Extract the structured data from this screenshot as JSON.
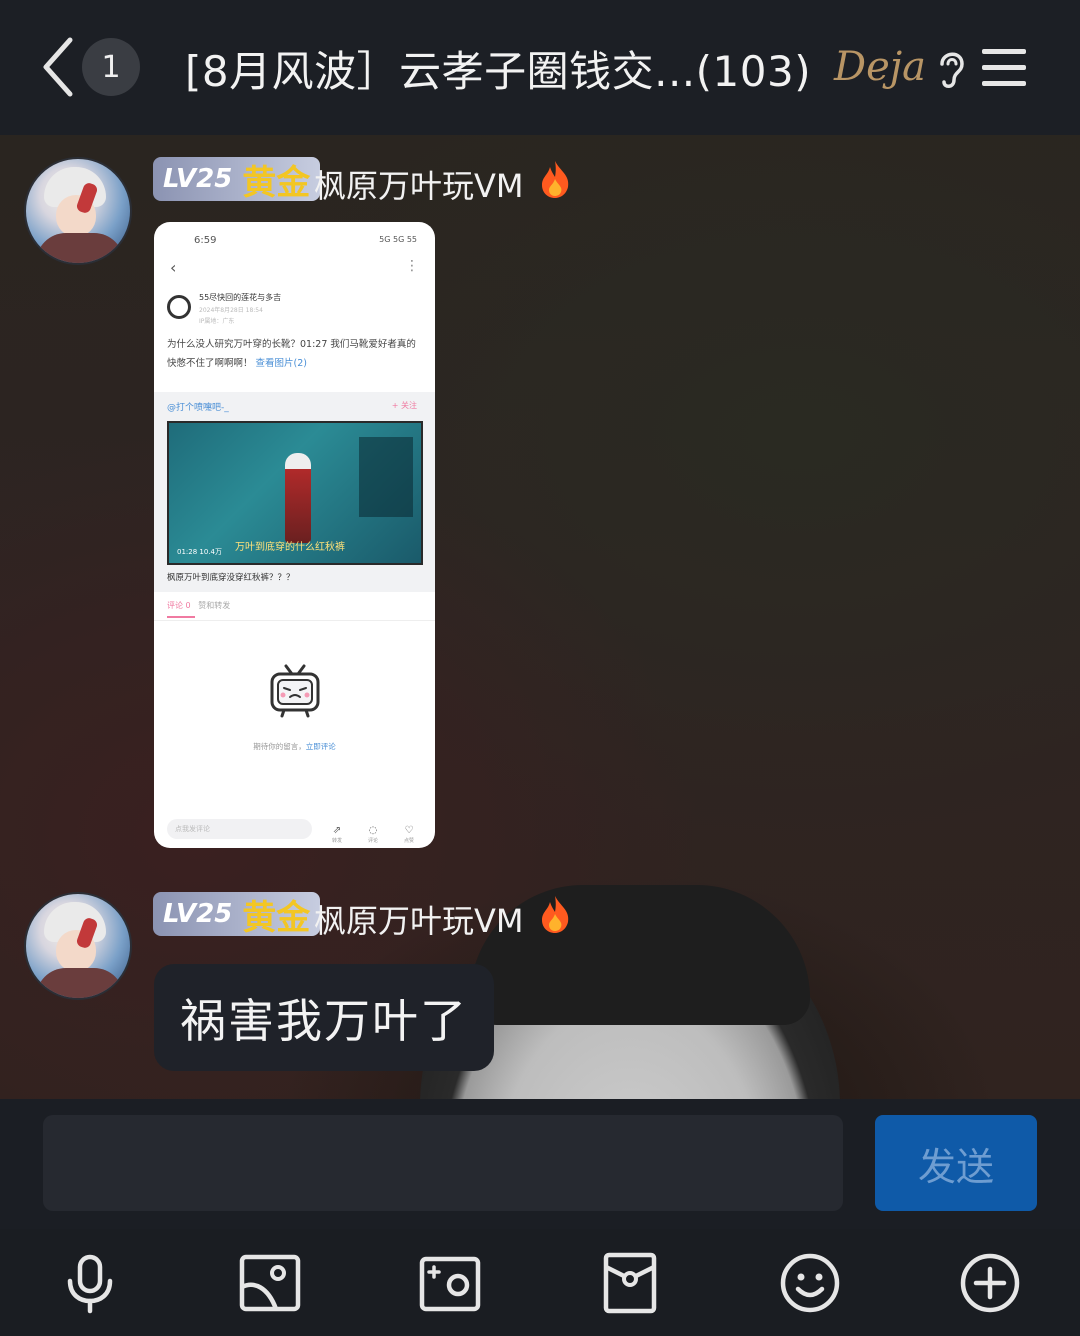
{
  "header": {
    "unread_count": "1",
    "title": "[8月风波］云孝子圈钱交...(103)",
    "brand_text": "Deja"
  },
  "messages": [
    {
      "level": "LV25",
      "rank": "黄金",
      "sender": "枫原万叶玩VM",
      "type": "image",
      "screenshot": {
        "status_time": "6:59",
        "status_right": "5G 5G 55",
        "post_author": "55尽快回的莲花与多吉",
        "post_date": "2024年8月28日 18:54",
        "post_location": "IP属地：广东",
        "post_text": "为什么没人研究万叶穿的长靴？01:27 我们马靴爱好者真的快憋不住了啊啊啊！",
        "post_link": "查看图片(2)",
        "at_user": "@打个喷嚏吧-_",
        "follow": "+ 关注",
        "video_caption_overlay": "万叶到底穿的什么红秋裤",
        "video_time": "01:28",
        "video_views": "10.4万",
        "video_title": "枫原万叶到底穿没穿红秋裤？？？",
        "tab_comments": "评论 0",
        "tab_repost": "赞和转发",
        "empty_text": "期待你的留言，",
        "empty_link": "立即评论",
        "input_placeholder": "点我发评论",
        "act_share": "转发",
        "act_comment": "评论",
        "act_like": "点赞"
      }
    },
    {
      "level": "LV25",
      "rank": "黄金",
      "sender": "枫原万叶玩VM",
      "type": "text",
      "text": "祸害我万叶了"
    }
  ],
  "input": {
    "value": "",
    "send_label": "发送"
  },
  "toolbar": {
    "icons": [
      "microphone-icon",
      "image-icon",
      "camera-icon",
      "red-packet-icon",
      "emoji-icon",
      "plus-icon"
    ]
  },
  "colors": {
    "header_bg": "#1c1f25",
    "send_button": "#0f5aa8",
    "rank_gold": "#f3c623",
    "link_blue": "#4a8fd6"
  }
}
